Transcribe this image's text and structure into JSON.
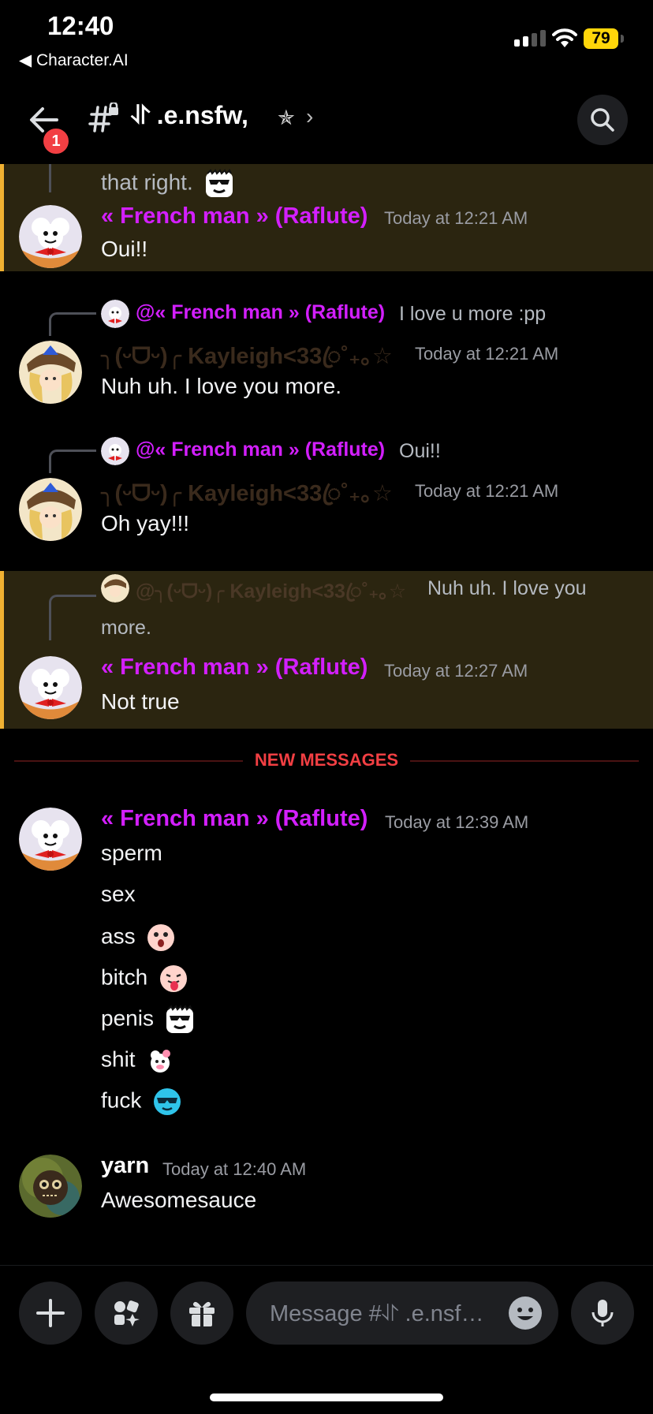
{
  "status_bar": {
    "time": "12:40",
    "back_app": "◀ Character.AI",
    "battery": "79"
  },
  "header": {
    "badge_count": "1",
    "channel_name": "⥯ .e.nsfw,",
    "channel_star": "✯",
    "chevron": "›"
  },
  "colors": {
    "highlight_bg": "#2b2510",
    "highlight_border": "#f0b132",
    "french_man": "#d31fff",
    "new_messages": "#f23f43"
  },
  "messages": [
    {
      "continuation": "that right."
    },
    {
      "author": "« French man » (Raflute)",
      "time": "Today at 12:21 AM",
      "text": "Oui!!"
    },
    {
      "reply_name": "@« French man » (Raflute)",
      "reply_text": "I love u more :pp",
      "author": "╮(ᵕᗜᵕ)╭ Kayleigh<33ꦿ˚₊｡☆",
      "time": "Today at 12:21 AM",
      "text": "Nuh uh. I love you more."
    },
    {
      "reply_name": "@« French man » (Raflute)",
      "reply_text": "Oui!!",
      "author": "╮(ᵕᗜᵕ)╭ Kayleigh<33ꦿ˚₊｡☆",
      "time": "Today at 12:21 AM",
      "text": "Oh yay!!!"
    },
    {
      "reply_name": "@╮(ᵕᗜᵕ)╭ Kayleigh<33ꦿ˚₊｡☆",
      "reply_text": "Nuh uh. I love you",
      "reply_text_2": "more.",
      "author": "« French man » (Raflute)",
      "time": "Today at 12:27 AM",
      "text": "Not true"
    },
    {
      "author": "« French man » (Raflute)",
      "time": "Today at 12:39 AM",
      "lines": [
        "sperm",
        "sex",
        "ass",
        "bitch",
        "penis",
        "shit",
        "fuck"
      ]
    },
    {
      "author": "yarn",
      "time": "Today at 12:40 AM",
      "text": "Awesomesauce"
    }
  ],
  "divider": "NEW MESSAGES",
  "composer": {
    "placeholder": "Message #⥯ .e.nsf…"
  },
  "icons": {
    "back": "arrow-left-icon",
    "channel": "locked-hash-icon",
    "search": "search-icon",
    "plus": "plus-icon",
    "apps": "apps-icon",
    "gift": "gift-icon",
    "emoji": "emoji-icon",
    "mic": "microphone-icon"
  }
}
